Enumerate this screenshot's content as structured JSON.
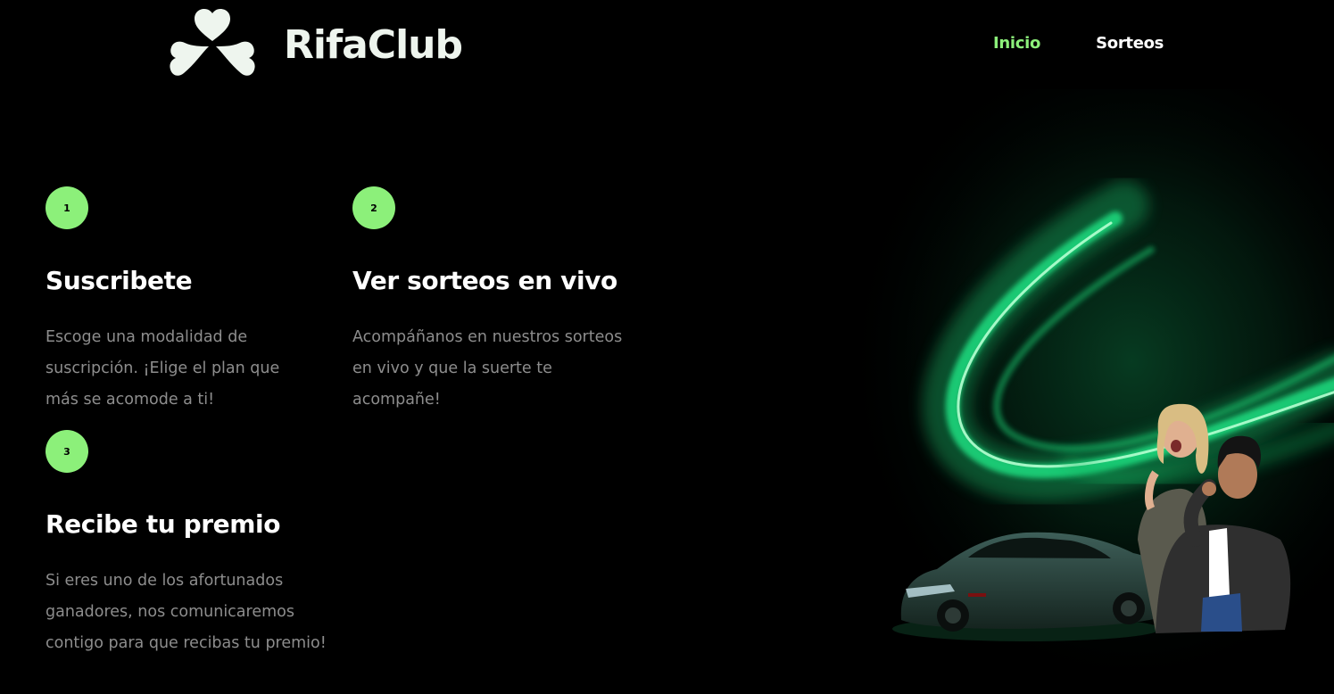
{
  "brand": {
    "name": "RifaClub",
    "logo_icon": "clover-hearts-icon",
    "accent_color": "#8cf07a"
  },
  "nav": {
    "items": [
      {
        "label": "Inicio",
        "active": true
      },
      {
        "label": "Sorteos",
        "active": false
      }
    ]
  },
  "steps": [
    {
      "number": "1",
      "title": "Suscribete",
      "text": "Escoge una modalidad de suscripción. ¡Elige el plan que más se acomode a ti!"
    },
    {
      "number": "2",
      "title": "Ver sorteos en vivo",
      "text": "Acompáñanos en nuestros sorteos en vivo y que la suerte te acompañe!"
    },
    {
      "number": "3",
      "title": "Recibe tu premio",
      "text": "Si eres uno de los afortunados ganadores, nos comunicaremos contigo para que recibas tu premio!"
    }
  ],
  "hero": {
    "image": "promo-car-winners-image"
  }
}
